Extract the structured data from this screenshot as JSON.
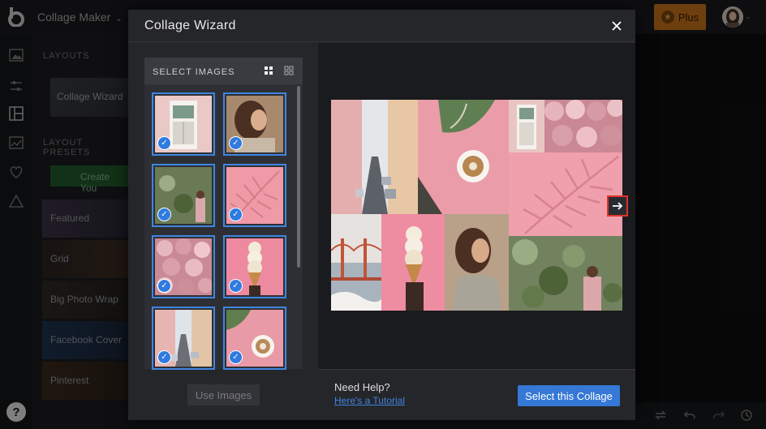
{
  "app": {
    "title": "Collage Maker",
    "plus_label": "Plus"
  },
  "panel": {
    "layouts_heading": "LAYOUTS",
    "layout_thumb_label": "Collage Wizard",
    "presets_heading": "LAYOUT PRESETS",
    "create_label": "Create You",
    "presets": [
      "Featured",
      "Grid",
      "Big Photo Wrap",
      "Facebook Cover",
      "Pinterest"
    ]
  },
  "modal": {
    "title": "Collage Wizard",
    "select_images_label": "SELECT IMAGES",
    "use_images_label": "Use Images",
    "help_title": "Need Help?",
    "help_link": "Here's a Tutorial",
    "select_collage_label": "Select this Collage"
  },
  "thumbnails": [
    {
      "subject": "pink-window",
      "selected": true
    },
    {
      "subject": "woman-portrait",
      "selected": true
    },
    {
      "subject": "ivy-woman",
      "selected": true
    },
    {
      "subject": "pink-palm",
      "selected": true
    },
    {
      "subject": "pink-roses",
      "selected": true
    },
    {
      "subject": "ice-cream-cone",
      "selected": true
    },
    {
      "subject": "city-street",
      "selected": true
    },
    {
      "subject": "coffee-cup",
      "selected": true
    }
  ],
  "colors": {
    "accent": "#3578d6",
    "selection": "#3f86e0",
    "plus": "#c9741a",
    "highlight": "#e0332a"
  }
}
